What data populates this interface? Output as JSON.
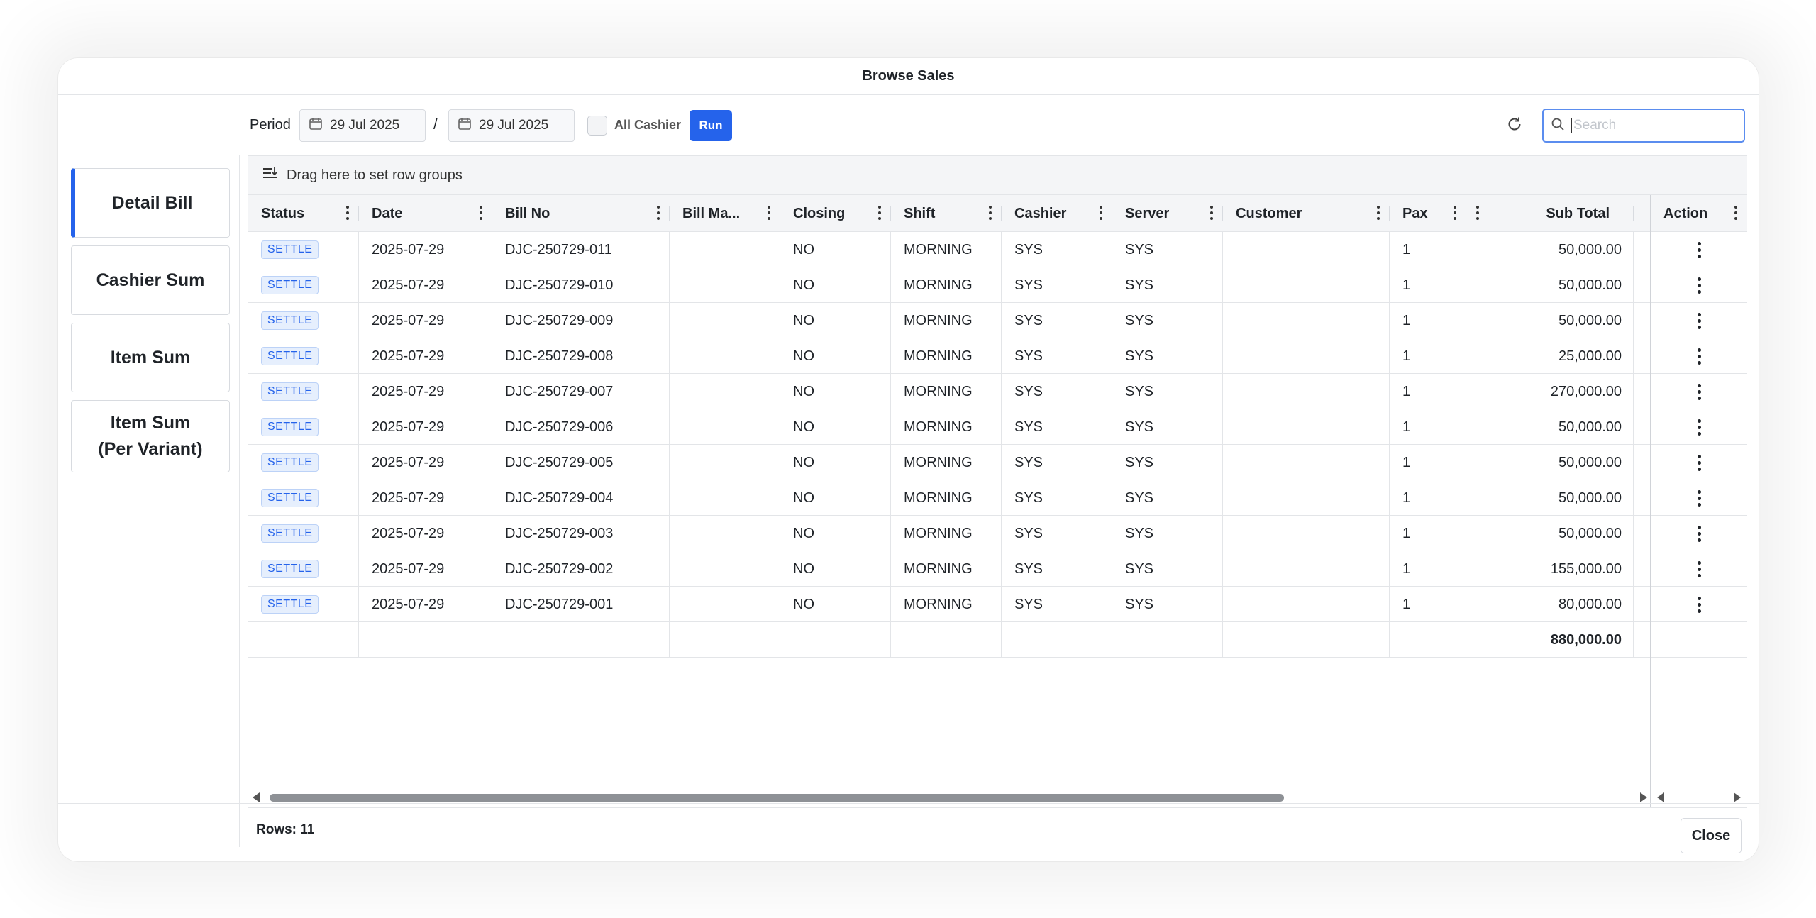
{
  "dialog": {
    "title": "Browse Sales",
    "close_label": "Close"
  },
  "sidenav": {
    "items": [
      {
        "label": "Detail Bill",
        "active": true
      },
      {
        "label": "Cashier Sum",
        "active": false
      },
      {
        "label": "Item Sum",
        "active": false
      },
      {
        "label": "Item Sum\n(Per Variant)",
        "active": false
      }
    ]
  },
  "toolbar": {
    "period_label": "Period",
    "date_from": "29 Jul 2025",
    "separator": "/",
    "date_to": "29 Jul 2025",
    "all_cashier_label": "All Cashier",
    "all_cashier_checked": false,
    "run_label": "Run",
    "search_placeholder": "Search",
    "search_value": ""
  },
  "grid": {
    "group_hint": "Drag here to set row groups",
    "columns": [
      "Status",
      "Date",
      "Bill No",
      "Bill Ma...",
      "Closing",
      "Shift",
      "Cashier",
      "Server",
      "Customer",
      "Pax",
      "",
      "Sub Total",
      "Action"
    ],
    "rows": [
      {
        "status": "SETTLE",
        "date": "2025-07-29",
        "bill_no": "DJC-250729-011",
        "bill_ma": "",
        "closing": "NO",
        "shift": "MORNING",
        "cashier": "SYS",
        "server": "SYS",
        "customer": "",
        "pax": "1",
        "sub_total": "50,000.00"
      },
      {
        "status": "SETTLE",
        "date": "2025-07-29",
        "bill_no": "DJC-250729-010",
        "bill_ma": "",
        "closing": "NO",
        "shift": "MORNING",
        "cashier": "SYS",
        "server": "SYS",
        "customer": "",
        "pax": "1",
        "sub_total": "50,000.00"
      },
      {
        "status": "SETTLE",
        "date": "2025-07-29",
        "bill_no": "DJC-250729-009",
        "bill_ma": "",
        "closing": "NO",
        "shift": "MORNING",
        "cashier": "SYS",
        "server": "SYS",
        "customer": "",
        "pax": "1",
        "sub_total": "50,000.00"
      },
      {
        "status": "SETTLE",
        "date": "2025-07-29",
        "bill_no": "DJC-250729-008",
        "bill_ma": "",
        "closing": "NO",
        "shift": "MORNING",
        "cashier": "SYS",
        "server": "SYS",
        "customer": "",
        "pax": "1",
        "sub_total": "25,000.00"
      },
      {
        "status": "SETTLE",
        "date": "2025-07-29",
        "bill_no": "DJC-250729-007",
        "bill_ma": "",
        "closing": "NO",
        "shift": "MORNING",
        "cashier": "SYS",
        "server": "SYS",
        "customer": "",
        "pax": "1",
        "sub_total": "270,000.00"
      },
      {
        "status": "SETTLE",
        "date": "2025-07-29",
        "bill_no": "DJC-250729-006",
        "bill_ma": "",
        "closing": "NO",
        "shift": "MORNING",
        "cashier": "SYS",
        "server": "SYS",
        "customer": "",
        "pax": "1",
        "sub_total": "50,000.00"
      },
      {
        "status": "SETTLE",
        "date": "2025-07-29",
        "bill_no": "DJC-250729-005",
        "bill_ma": "",
        "closing": "NO",
        "shift": "MORNING",
        "cashier": "SYS",
        "server": "SYS",
        "customer": "",
        "pax": "1",
        "sub_total": "50,000.00"
      },
      {
        "status": "SETTLE",
        "date": "2025-07-29",
        "bill_no": "DJC-250729-004",
        "bill_ma": "",
        "closing": "NO",
        "shift": "MORNING",
        "cashier": "SYS",
        "server": "SYS",
        "customer": "",
        "pax": "1",
        "sub_total": "50,000.00"
      },
      {
        "status": "SETTLE",
        "date": "2025-07-29",
        "bill_no": "DJC-250729-003",
        "bill_ma": "",
        "closing": "NO",
        "shift": "MORNING",
        "cashier": "SYS",
        "server": "SYS",
        "customer": "",
        "pax": "1",
        "sub_total": "50,000.00"
      },
      {
        "status": "SETTLE",
        "date": "2025-07-29",
        "bill_no": "DJC-250729-002",
        "bill_ma": "",
        "closing": "NO",
        "shift": "MORNING",
        "cashier": "SYS",
        "server": "SYS",
        "customer": "",
        "pax": "1",
        "sub_total": "155,000.00"
      },
      {
        "status": "SETTLE",
        "date": "2025-07-29",
        "bill_no": "DJC-250729-001",
        "bill_ma": "",
        "closing": "NO",
        "shift": "MORNING",
        "cashier": "SYS",
        "server": "SYS",
        "customer": "",
        "pax": "1",
        "sub_total": "80,000.00"
      }
    ],
    "total_sub_total": "880,000.00",
    "rows_label": "Rows: 11"
  },
  "colors": {
    "accent": "#2563eb",
    "badge_bg": "#e6effd",
    "border": "#e3e5e8"
  },
  "icons": [
    "calendar-icon",
    "refresh-icon",
    "search-icon",
    "row-groups-icon",
    "column-menu-icon",
    "row-action-icon"
  ]
}
